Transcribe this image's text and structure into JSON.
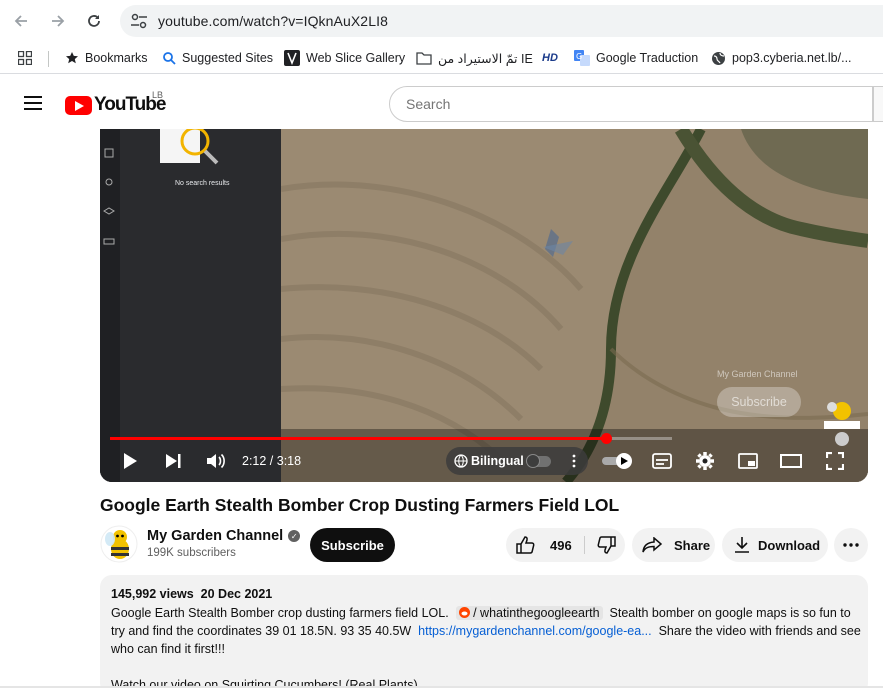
{
  "browser": {
    "url": "youtube.com/watch?v=IQknAuX2LI8",
    "bookmarks": [
      {
        "label": "Bookmarks",
        "icon": "star-icon"
      },
      {
        "label": "Suggested Sites",
        "icon": "search-icon"
      },
      {
        "label": "Web Slice Gallery",
        "icon": "web-slice-icon"
      },
      {
        "label": "تمّ الاستيراد من IE",
        "icon": "folder-icon"
      },
      {
        "label": "HD",
        "icon": "hd-icon"
      },
      {
        "label": "Google Traduction",
        "icon": "translate-icon"
      },
      {
        "label": "pop3.cyberia.net.lb/...",
        "icon": "globe-icon"
      }
    ]
  },
  "header": {
    "logo_text": "YouTube",
    "country_code": "LB",
    "search_placeholder": "Search"
  },
  "player": {
    "sidebar_text": "No search results",
    "time": "2:12 / 3:18",
    "progress": 0.884,
    "buffered": 1.0,
    "bilingual_label": "Bilingual",
    "watermark_channel": "My Garden Channel",
    "watermark_subscribe": "Subscribe"
  },
  "video": {
    "title": "Google Earth Stealth Bomber Crop Dusting Farmers Field LOL",
    "channel_name": "My Garden Channel",
    "subscribers": "199K subscribers",
    "subscribe_label": "Subscribe",
    "likes": "496",
    "share_label": "Share",
    "download_label": "Download"
  },
  "description": {
    "views": "145,992 views",
    "date": "20 Dec 2021",
    "text1": "Google Earth Stealth Bomber crop dusting farmers field LOL.",
    "reddit_tag": "/ whatinthegoogleearth",
    "text2": "Stealth bomber on google maps is so fun to try and find the coordinates 39 01 18.5N. 93 35 40.5W",
    "link": "https://mygardenchannel.com/google-ea...",
    "text3": "Share the video with friends and see who can find it first!!!",
    "text4": "Watch our video on Squirting Cucumbers! (Real Plants)"
  },
  "colors": {
    "accent": "#ff0000",
    "link": "#065fd4",
    "chip_bg": "#f2f2f2"
  }
}
